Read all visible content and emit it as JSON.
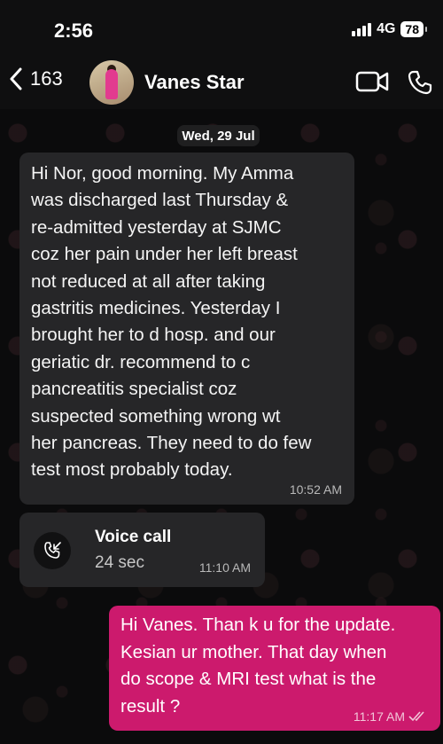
{
  "status_bar": {
    "time": "2:56",
    "network": "4G",
    "battery": "78"
  },
  "header": {
    "back_count": "163",
    "contact_name": "Vanes Star"
  },
  "date_chip": "Wed, 29 Jul",
  "messages": [
    {
      "text": "Hi Nor, good morning. My Amma\nwas discharged last Thursday &\nre-admitted yesterday at SJMC\ncoz her pain under her left breast\nnot reduced at all after taking\ngastritis medicines. Yesterday I\nbrought her to d hosp. and our\ngeriatic dr.  recommend to c\npancreatitis specialist coz\nsuspected something wrong wt\nher pancreas. They need to do few\ntest most probably today.",
      "time": "10:52 AM"
    }
  ],
  "call": {
    "title": "Voice call",
    "duration": "24 sec",
    "time": "11:10 AM"
  },
  "outgoing": {
    "text": "Hi Vanes. Than k u for the update.\nKesian ur mother. That day when\ndo scope & MRI test what is the\nresult ?",
    "time": "11:17 AM"
  },
  "colors": {
    "outgoing_bubble": "#cc1a6d",
    "incoming_bubble": "#262628",
    "background": "#0b0b0c"
  },
  "icons": [
    "back-chevron-icon",
    "video-call-icon",
    "phone-icon",
    "missed-call-icon",
    "read-ticks-icon"
  ]
}
